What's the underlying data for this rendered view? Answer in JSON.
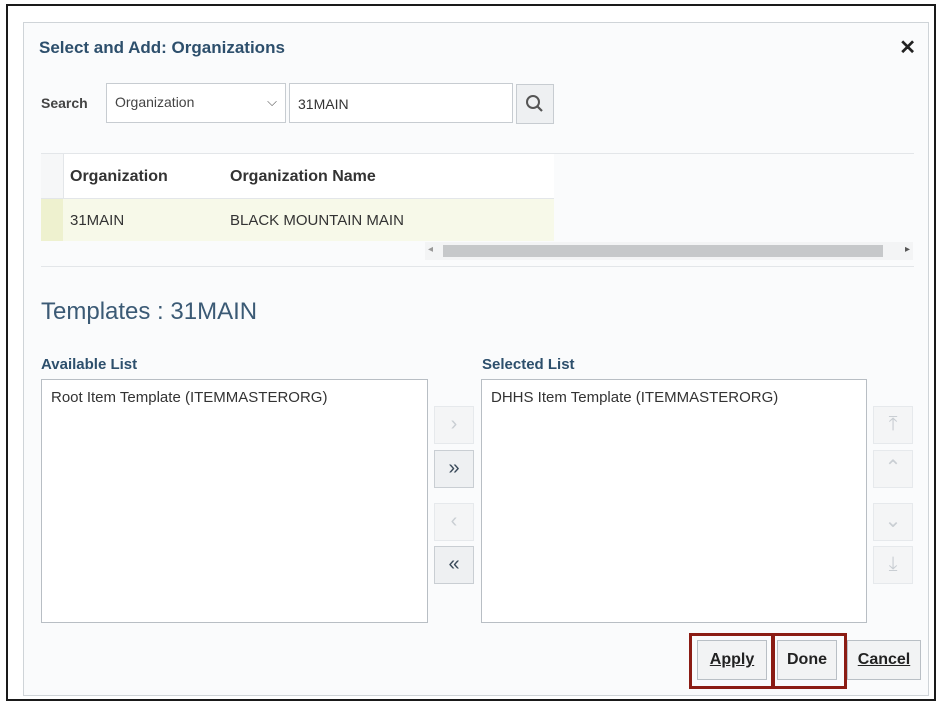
{
  "dialog": {
    "title": "Select and Add: Organizations",
    "close_icon": "close-icon"
  },
  "search": {
    "label": "Search",
    "field_select": "Organization",
    "value": "31MAIN",
    "search_icon": "search-icon"
  },
  "table": {
    "columns": [
      "Organization",
      "Organization Name"
    ],
    "rows": [
      {
        "organization": "31MAIN",
        "organization_name": "BLACK MOUNTAIN MAIN"
      }
    ]
  },
  "templates": {
    "title": "Templates : 31MAIN",
    "available_label": "Available List",
    "selected_label": "Selected List",
    "available_items": [
      "Root Item Template (ITEMMASTERORG)"
    ],
    "selected_items": [
      "DHHS Item Template (ITEMMASTERORG)"
    ]
  },
  "shuttle": {
    "move": "›",
    "move_all": "»",
    "remove": "‹",
    "remove_all": "«",
    "top": "⤒",
    "up": "⌃",
    "down": "⌄",
    "bottom": "⤓"
  },
  "actions": {
    "apply": "Apply",
    "done": "Done",
    "cancel": "Cancel"
  },
  "colors": {
    "highlight_border": "#8b1c14",
    "title_text": "#2d4f6c",
    "selected_row": "#f7f9e9"
  }
}
